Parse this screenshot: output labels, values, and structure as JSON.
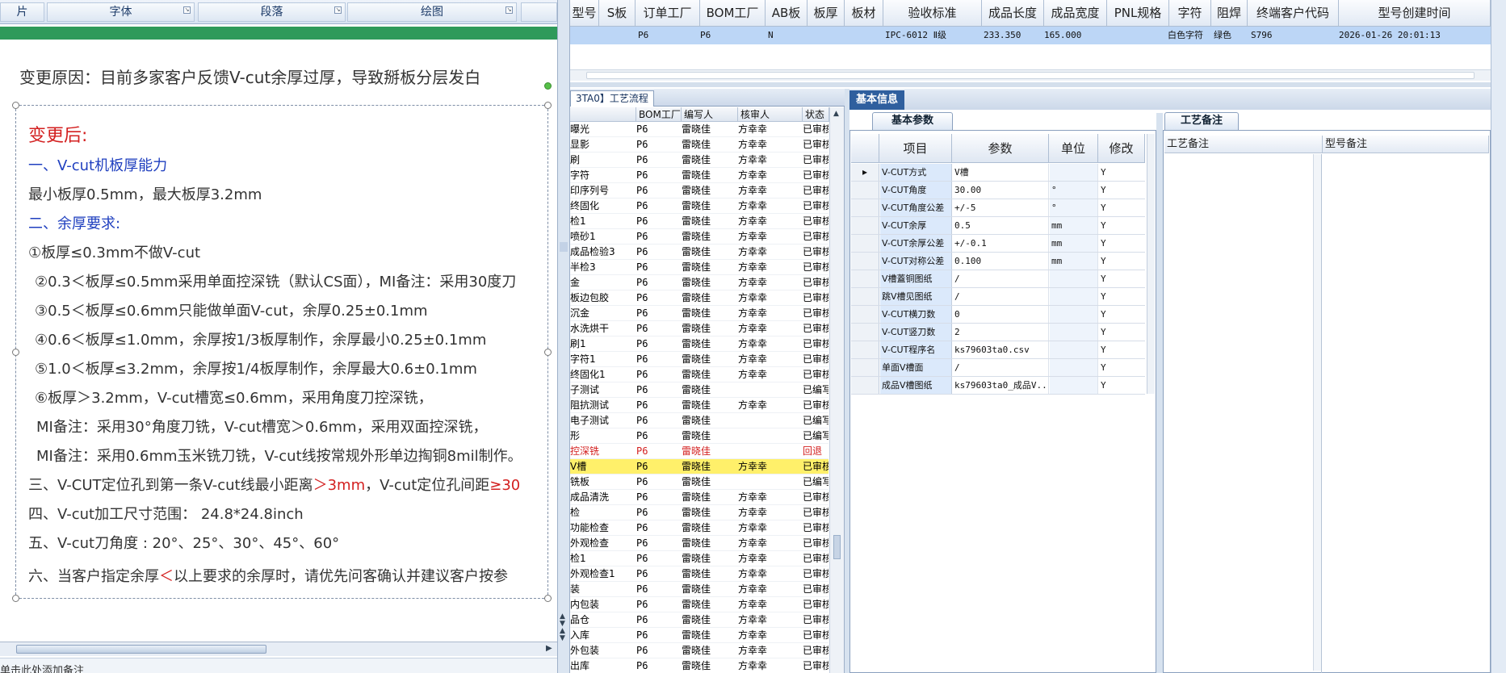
{
  "ribbon": {
    "groups": [
      "片",
      "字体",
      "段落",
      "绘图"
    ]
  },
  "doc": {
    "change_reason": "变更原因：目前多家客户反馈V-cut余厚过厚，导致掰板分层发白",
    "after_title": "变更后:",
    "sec1": "一、V-cut机板厚能力",
    "line_min_max": "最小板厚0.5mm，最大板厚3.2mm",
    "sec2": "二、余厚要求:",
    "req1": "①板厚≤0.3mm不做V-cut",
    "req2": "②0.3＜板厚≤0.5mm采用单面控深铣（默认CS面），MI备注：采用30度刀",
    "req3": "③0.5＜板厚≤0.6mm只能做单面V-cut，余厚0.25±0.1mm",
    "req4": "④0.6＜板厚≤1.0mm，余厚按1/3板厚制作，余厚最小0.25±0.1mm",
    "req5": "⑤1.0＜板厚≤3.2mm，余厚按1/4板厚制作，余厚最大0.6±0.1mm",
    "req6": "⑥板厚＞3.2mm，V-cut槽宽≤0.6mm，采用角度刀控深铣，",
    "mi1": "MI备注：采用30°角度刀铣，V-cut槽宽＞0.6mm，采用双面控深铣，",
    "mi2": "MI备注：采用0.6mm玉米铣刀铣，V-cut线按常规外形单边掏铜8mil制作。",
    "sec3_a": "三、V-CUT定位孔到第一条V-cut线最小距离",
    "sec3_b": "＞3mm",
    "sec3_c": "，V-cut定位孔间距",
    "sec3_d": "≥30",
    "sec4": "四、V-cut加工尺寸范围：  24.8*24.8inch",
    "sec5": "五、V-cut刀角度 : 20°、25°、30°、45°、60°",
    "sec6_a": "六、当客户指定余厚",
    "sec6_b": "＜",
    "sec6_c": "以上要求的余厚时，请优先问客确认并建议客户按参",
    "bottom_hint": "单击此处添加备注"
  },
  "top_grid": {
    "headers": [
      "型号",
      "S板",
      "订单工厂",
      "BOM工厂",
      "AB板",
      "板厚",
      "板材",
      "验收标准",
      "成品长度",
      "成品宽度",
      "PNL规格",
      "字符",
      "阻焊",
      "终端客户代码",
      "型号创建时间"
    ],
    "row": [
      "",
      "",
      "P6",
      "P6",
      "N",
      "",
      "",
      "IPC-6012 Ⅱ级",
      "233.350",
      "165.000",
      "",
      "白色字符",
      "绿色",
      "S796",
      "2026-01-26 20:01:13"
    ]
  },
  "process": {
    "tab_label": "3TA0】工艺流程",
    "headers": [
      "BOM工厂",
      "编写人",
      "核审人",
      "状态"
    ],
    "rows": [
      {
        "name": "曝光",
        "bom": "P6",
        "writer": "雷晓佳",
        "reviewer": "方幸幸",
        "status": "已审核"
      },
      {
        "name": "显影",
        "bom": "P6",
        "writer": "雷晓佳",
        "reviewer": "方幸幸",
        "status": "已审核"
      },
      {
        "name": "刷",
        "bom": "P6",
        "writer": "雷晓佳",
        "reviewer": "方幸幸",
        "status": "已审核"
      },
      {
        "name": "字符",
        "bom": "P6",
        "writer": "雷晓佳",
        "reviewer": "方幸幸",
        "status": "已审核"
      },
      {
        "name": "印序列号",
        "bom": "P6",
        "writer": "雷晓佳",
        "reviewer": "方幸幸",
        "status": "已审核"
      },
      {
        "name": "终固化",
        "bom": "P6",
        "writer": "雷晓佳",
        "reviewer": "方幸幸",
        "status": "已审核"
      },
      {
        "name": "检1",
        "bom": "P6",
        "writer": "雷晓佳",
        "reviewer": "方幸幸",
        "status": "已审核"
      },
      {
        "name": "喷砂1",
        "bom": "P6",
        "writer": "雷晓佳",
        "reviewer": "方幸幸",
        "status": "已审核"
      },
      {
        "name": "成品检验3",
        "bom": "P6",
        "writer": "雷晓佳",
        "reviewer": "方幸幸",
        "status": "已审核"
      },
      {
        "name": "半检3",
        "bom": "P6",
        "writer": "雷晓佳",
        "reviewer": "方幸幸",
        "status": "已审核"
      },
      {
        "name": "金",
        "bom": "P6",
        "writer": "雷晓佳",
        "reviewer": "方幸幸",
        "status": "已审核"
      },
      {
        "name": "板边包胶",
        "bom": "P6",
        "writer": "雷晓佳",
        "reviewer": "方幸幸",
        "status": "已审核"
      },
      {
        "name": "沉金",
        "bom": "P6",
        "writer": "雷晓佳",
        "reviewer": "方幸幸",
        "status": "已审核"
      },
      {
        "name": "水洗烘干",
        "bom": "P6",
        "writer": "雷晓佳",
        "reviewer": "方幸幸",
        "status": "已审核"
      },
      {
        "name": "刷1",
        "bom": "P6",
        "writer": "雷晓佳",
        "reviewer": "方幸幸",
        "status": "已审核"
      },
      {
        "name": "字符1",
        "bom": "P6",
        "writer": "雷晓佳",
        "reviewer": "方幸幸",
        "status": "已审核"
      },
      {
        "name": "终固化1",
        "bom": "P6",
        "writer": "雷晓佳",
        "reviewer": "方幸幸",
        "status": "已审核"
      },
      {
        "name": "子测试",
        "bom": "P6",
        "writer": "雷晓佳",
        "reviewer": "",
        "status": "已编写"
      },
      {
        "name": "阻抗测试",
        "bom": "P6",
        "writer": "雷晓佳",
        "reviewer": "方幸幸",
        "status": "已审核"
      },
      {
        "name": "电子测试",
        "bom": "P6",
        "writer": "雷晓佳",
        "reviewer": "",
        "status": "已编写"
      },
      {
        "name": "形",
        "bom": "P6",
        "writer": "雷晓佳",
        "reviewer": "",
        "status": "已编写"
      },
      {
        "name": "控深铣",
        "bom": "P6",
        "writer": "雷晓佳",
        "reviewer": "",
        "status": "回退",
        "red": true
      },
      {
        "name": "V槽",
        "bom": "P6",
        "writer": "雷晓佳",
        "reviewer": "方幸幸",
        "status": "已审核",
        "selected": true
      },
      {
        "name": "铣板",
        "bom": "P6",
        "writer": "雷晓佳",
        "reviewer": "",
        "status": "已编写"
      },
      {
        "name": "成品清洗",
        "bom": "P6",
        "writer": "雷晓佳",
        "reviewer": "方幸幸",
        "status": "已审核"
      },
      {
        "name": "检",
        "bom": "P6",
        "writer": "雷晓佳",
        "reviewer": "方幸幸",
        "status": "已审核"
      },
      {
        "name": "功能检查",
        "bom": "P6",
        "writer": "雷晓佳",
        "reviewer": "方幸幸",
        "status": "已审核"
      },
      {
        "name": "外观检查",
        "bom": "P6",
        "writer": "雷晓佳",
        "reviewer": "方幸幸",
        "status": "已审核"
      },
      {
        "name": "检1",
        "bom": "P6",
        "writer": "雷晓佳",
        "reviewer": "方幸幸",
        "status": "已审核"
      },
      {
        "name": "外观检查1",
        "bom": "P6",
        "writer": "雷晓佳",
        "reviewer": "方幸幸",
        "status": "已审核"
      },
      {
        "name": "装",
        "bom": "P6",
        "writer": "雷晓佳",
        "reviewer": "方幸幸",
        "status": "已审核"
      },
      {
        "name": "内包装",
        "bom": "P6",
        "writer": "雷晓佳",
        "reviewer": "方幸幸",
        "status": "已审核"
      },
      {
        "name": "品仓",
        "bom": "P6",
        "writer": "雷晓佳",
        "reviewer": "方幸幸",
        "status": "已审核"
      },
      {
        "name": "入库",
        "bom": "P6",
        "writer": "雷晓佳",
        "reviewer": "方幸幸",
        "status": "已审核"
      },
      {
        "name": "外包装",
        "bom": "P6",
        "writer": "雷晓佳",
        "reviewer": "方幸幸",
        "status": "已审核"
      },
      {
        "name": "出库",
        "bom": "P6",
        "writer": "雷晓佳",
        "reviewer": "方幸幸",
        "status": "已审核"
      }
    ]
  },
  "basic_info": {
    "tab_label": "基本信息",
    "subtab_label": "基本参数",
    "headers": [
      "项目",
      "参数",
      "单位",
      "修改"
    ],
    "rows": [
      {
        "item": "V-CUT方式",
        "param": "V槽",
        "unit": "",
        "mod": "Y",
        "current": true
      },
      {
        "item": "V-CUT角度",
        "param": "30.00",
        "unit": "°",
        "mod": "Y"
      },
      {
        "item": "V-CUT角度公差",
        "param": "+/-5",
        "unit": "°",
        "mod": "Y"
      },
      {
        "item": "V-CUT余厚",
        "param": "0.5",
        "unit": "mm",
        "mod": "Y"
      },
      {
        "item": "V-CUT余厚公差",
        "param": "+/-0.1",
        "unit": "mm",
        "mod": "Y"
      },
      {
        "item": "V-CUT对称公差",
        "param": "0.100",
        "unit": "mm",
        "mod": "Y"
      },
      {
        "item": "V槽蓋铜图纸",
        "param": "/",
        "unit": "",
        "mod": "Y"
      },
      {
        "item": "跳V槽见图纸",
        "param": "/",
        "unit": "",
        "mod": "Y"
      },
      {
        "item": "V-CUT横刀数",
        "param": "0",
        "unit": "",
        "mod": "Y"
      },
      {
        "item": "V-CUT竖刀数",
        "param": "2",
        "unit": "",
        "mod": "Y"
      },
      {
        "item": "V-CUT程序名",
        "param": "ks79603ta0.csv",
        "unit": "",
        "mod": "Y"
      },
      {
        "item": "单面V槽面",
        "param": "/",
        "unit": "",
        "mod": "Y"
      },
      {
        "item": "成品V槽图纸",
        "param": "ks79603ta0_成品V...",
        "unit": "",
        "mod": "Y"
      }
    ]
  },
  "process_notes": {
    "tab_label": "工艺备注",
    "headers": [
      "工艺备注",
      "型号备注"
    ]
  },
  "colors": {
    "selected_row": "#fff06a",
    "grid_selection": "#bcd6f6",
    "accent_blue": "#2f5f9e",
    "status_red": "#d32020",
    "green_bar": "#2e9a5a"
  }
}
